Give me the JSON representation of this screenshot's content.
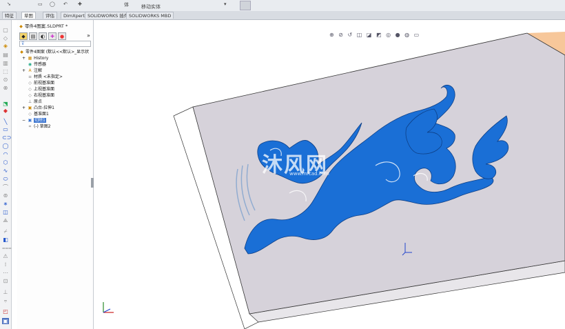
{
  "toolbar": {
    "items": [
      "体",
      "移动实体"
    ]
  },
  "tabs": [
    {
      "label": "特征",
      "active": false
    },
    {
      "label": "草图",
      "active": true
    },
    {
      "label": "评估",
      "active": false
    },
    {
      "label": "DimXpert",
      "active": false
    },
    {
      "label": "SOLIDWORKS 插件",
      "active": false
    },
    {
      "label": "SOLIDWORKS MBD",
      "active": false
    }
  ],
  "window_title": "零件4图案.SLDPRT *",
  "feature_tree": {
    "root": "零件4图案 (默认<<默认>_显示状",
    "items": [
      {
        "label": "History",
        "icon": "history-icon"
      },
      {
        "label": "传感器",
        "icon": "sensor-icon"
      },
      {
        "label": "注解",
        "icon": "annotation-icon"
      },
      {
        "label": "材质 <未指定>",
        "icon": "material-icon"
      },
      {
        "label": "前视基准面",
        "icon": "plane-icon"
      },
      {
        "label": "上视基准面",
        "icon": "plane-icon"
      },
      {
        "label": "右视基准面",
        "icon": "plane-icon"
      },
      {
        "label": "原点",
        "icon": "origin-icon"
      },
      {
        "label": "凸台-拉伸1",
        "icon": "extrude-icon"
      },
      {
        "label": "基准面1",
        "icon": "plane-icon"
      },
      {
        "label": "切除1",
        "icon": "cut-icon",
        "selected": true
      },
      {
        "label": "(-) 草图2",
        "icon": "sketch-icon"
      }
    ]
  },
  "watermark": {
    "text": "沐风网",
    "url": "www.mfcad.com"
  },
  "colors": {
    "pattern_blue": "#1a6fd6",
    "face_grey": "#d4d0d8",
    "edge_orange": "#f0a050",
    "selection": "#3a74d0"
  }
}
